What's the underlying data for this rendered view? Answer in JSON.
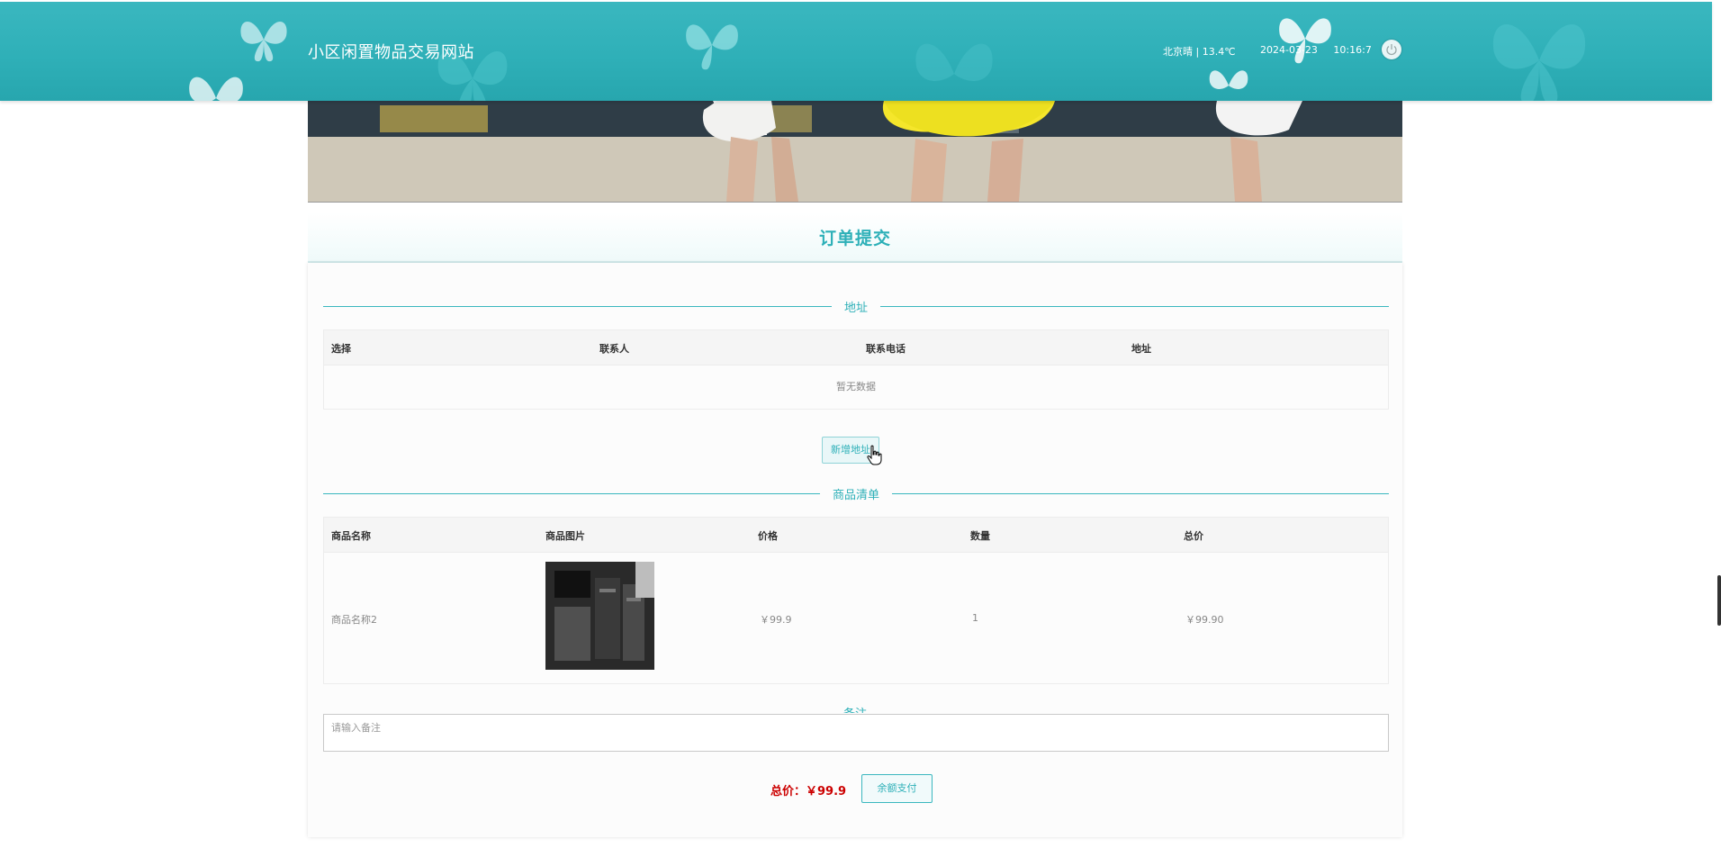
{
  "header": {
    "title": "小区闲置物品交易网站",
    "weather": "北京晴 | 13.4℃",
    "datetime": "2024-03-23 10:16:7",
    "power_icon": "power-icon"
  },
  "page": {
    "heading": "订单提交"
  },
  "address": {
    "label": "地址",
    "columns": [
      "选择",
      "联系人",
      "联系电话",
      "地址"
    ],
    "empty_text": "暂无数据",
    "add_button": "新增地址"
  },
  "goods": {
    "label": "商品清单",
    "columns": [
      "商品名称",
      "商品图片",
      "价格",
      "数量",
      "总价"
    ],
    "rows": [
      {
        "name": "商品名称2",
        "image": "product-photo",
        "price": "￥99.9",
        "quantity": "1",
        "total": "￥99.90"
      }
    ]
  },
  "remark": {
    "label": "备注",
    "placeholder": "请输入备注",
    "value": ""
  },
  "footer": {
    "total_label": "总价：￥99.9",
    "pay_button": "余额支付"
  },
  "colors": {
    "accent": "#2eb0b8",
    "header_bg": "#33b3bb",
    "price_red": "#cc0000"
  }
}
